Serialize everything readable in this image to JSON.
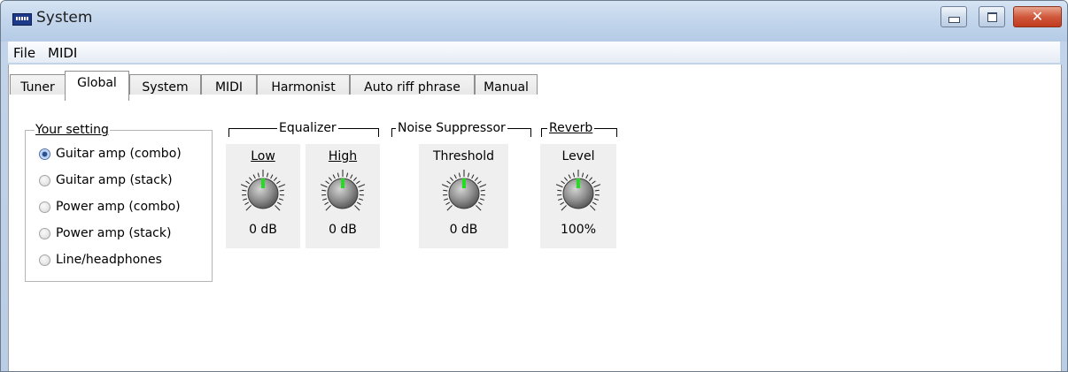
{
  "window": {
    "title": "System"
  },
  "menu": {
    "items": [
      "File",
      "MIDI"
    ]
  },
  "tabs": [
    {
      "label": "Tuner"
    },
    {
      "label": "Global",
      "active": true
    },
    {
      "label": "System"
    },
    {
      "label": "MIDI"
    },
    {
      "label": "Harmonist"
    },
    {
      "label": "Auto riff phrase"
    },
    {
      "label": "Manual"
    }
  ],
  "your_setting": {
    "title": "Your setting",
    "options": [
      {
        "label": "Guitar amp (combo)",
        "checked": true
      },
      {
        "label": "Guitar amp (stack)",
        "checked": false
      },
      {
        "label": "Power amp (combo)",
        "checked": false
      },
      {
        "label": "Power amp (stack)",
        "checked": false
      },
      {
        "label": "Line/headphones",
        "checked": false
      }
    ]
  },
  "equalizer": {
    "title": "Equalizer",
    "low": {
      "label": "Low",
      "value": "0 dB"
    },
    "high": {
      "label": "High",
      "value": "0 dB"
    }
  },
  "noise_suppressor": {
    "title": "Noise Suppressor",
    "threshold": {
      "label": "Threshold",
      "value": "0 dB"
    }
  },
  "reverb": {
    "title": "Reverb",
    "level": {
      "label": "Level",
      "value": "100%"
    }
  },
  "colors": {
    "knob_indicator": "#22dd22",
    "knob_body": "#8f8f8f",
    "titlebar": "#c3d6ec",
    "close_button": "#d0583c"
  }
}
